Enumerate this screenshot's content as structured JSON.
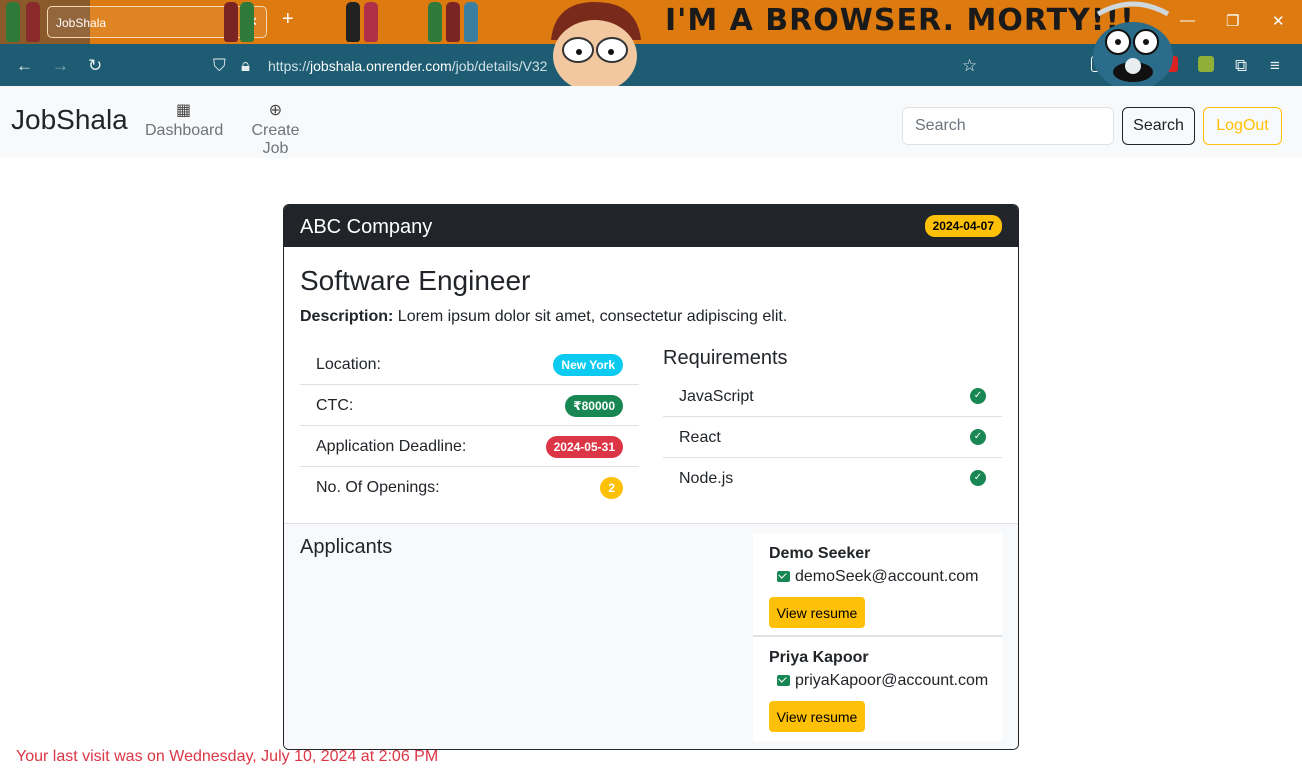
{
  "browser": {
    "tab_title": "JobShala",
    "theme_text": "I'M A BROWSER. MORTY!!!",
    "url_prefix": "https://",
    "url_host": "jobshala.onrender.com",
    "url_path": "/job/details/V32",
    "icons": [
      "tab-list-icon",
      "close-icon",
      "plus-icon",
      "back-icon",
      "forward-icon",
      "reload-icon",
      "shield-icon",
      "lock-icon",
      "star-icon",
      "pocket-icon",
      "profile-icon",
      "extension-icon",
      "puzzle-icon",
      "menu-icon",
      "minimize-icon",
      "maximize-icon",
      "window-close-icon"
    ]
  },
  "site": {
    "brand": "JobShala",
    "nav": [
      {
        "label": "Dashboard",
        "icon": "dashboard-icon"
      },
      {
        "label": "Create Job",
        "icon": "plus-circle-icon"
      }
    ],
    "search_placeholder": "Search",
    "search_button": "Search",
    "logout_button": "LogOut"
  },
  "job": {
    "company": "ABC Company",
    "posted_date": "2024-04-07",
    "title": "Software Engineer",
    "description_label": "Description:",
    "description": " Lorem ipsum dolor sit amet, consectetur adipiscing elit.",
    "details": [
      {
        "label": "Location:",
        "value": "New York",
        "color": "#0dcaf0"
      },
      {
        "label": "CTC:",
        "value": "₹80000",
        "color": "#198754"
      },
      {
        "label": "Application Deadline:",
        "value": "2024-05-31",
        "color": "#dc3545"
      },
      {
        "label": "No. Of Openings:",
        "value": "2",
        "color": "#ffc107"
      }
    ],
    "requirements_title": "Requirements",
    "requirements": [
      "JavaScript",
      "React",
      "Node.js"
    ]
  },
  "applicants": {
    "title": "Applicants",
    "items": [
      {
        "name": "Demo Seeker",
        "email": "demoSeek@account.com",
        "button": "View resume"
      },
      {
        "name": "Priya Kapoor",
        "email": "priyaKapoor@account.com",
        "button": "View resume"
      }
    ]
  },
  "footer": {
    "last_visit": "Your last visit was on Wednesday, July 10, 2024 at 2:06 PM"
  },
  "colors": {
    "accent_yellow": "#ffc107",
    "dark": "#212529",
    "success": "#198754",
    "danger": "#dc3545",
    "info": "#0dcaf0",
    "chrome_orange": "#dd7a10",
    "chrome_teal": "#1d5c72"
  }
}
